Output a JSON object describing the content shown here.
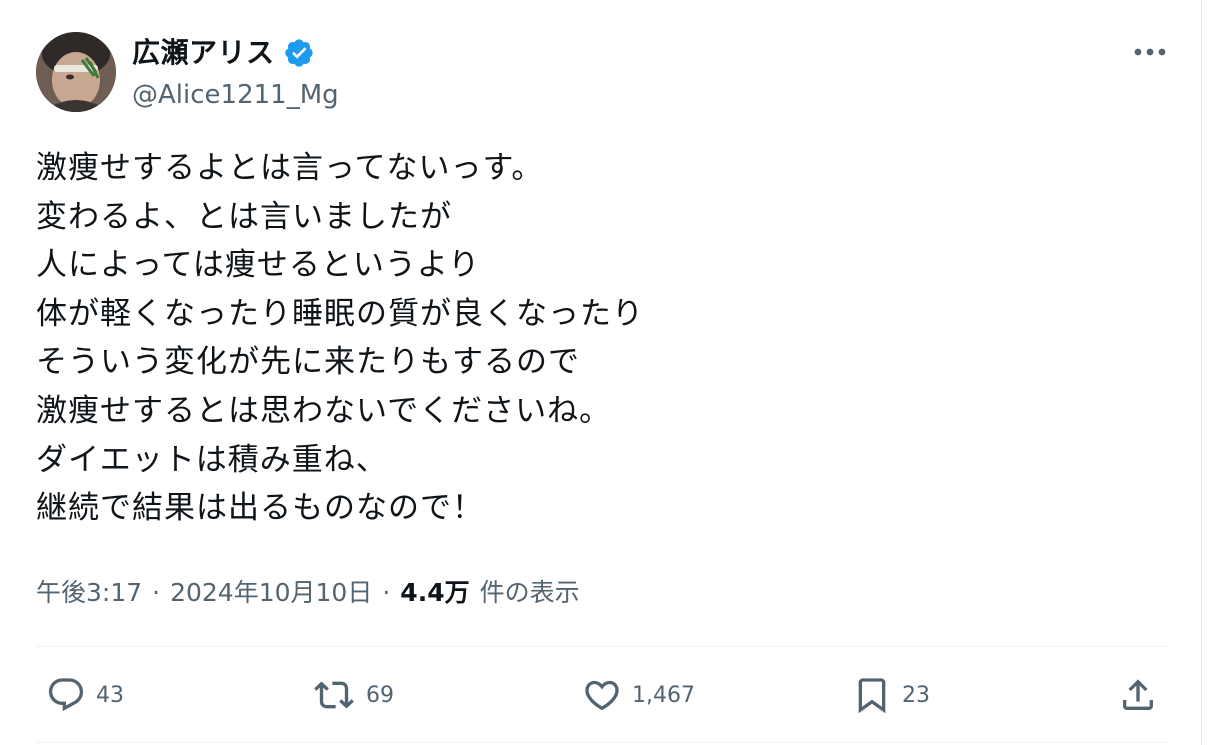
{
  "author": {
    "display_name": "広瀬アリス",
    "handle": "@Alice1211_Mg",
    "verified_color": "#1d9bf0"
  },
  "tweet": {
    "text": "激痩せするよとは言ってないっす。\n変わるよ、とは言いましたが\n人によっては痩せるというより\n体が軽くなったり睡眠の質が良くなったり\nそういう変化が先に来たりもするので\n激痩せするとは思わないでくださいね。\nダイエットは積み重ね、\n継続で結果は出るものなので！"
  },
  "meta": {
    "time": "午後3:17",
    "separator": "·",
    "date": "2024年10月10日",
    "views_count": "4.4万",
    "views_label": "件の表示"
  },
  "actions": {
    "replies": "43",
    "reposts": "69",
    "likes": "1,467",
    "bookmarks": "23"
  },
  "icons": {
    "more": "more-horizontal-icon",
    "reply": "reply-icon",
    "repost": "repost-icon",
    "like": "heart-icon",
    "bookmark": "bookmark-icon",
    "share": "share-icon"
  },
  "colors": {
    "text": "#0f1419",
    "secondary": "#536471",
    "verified": "#1d9bf0"
  }
}
